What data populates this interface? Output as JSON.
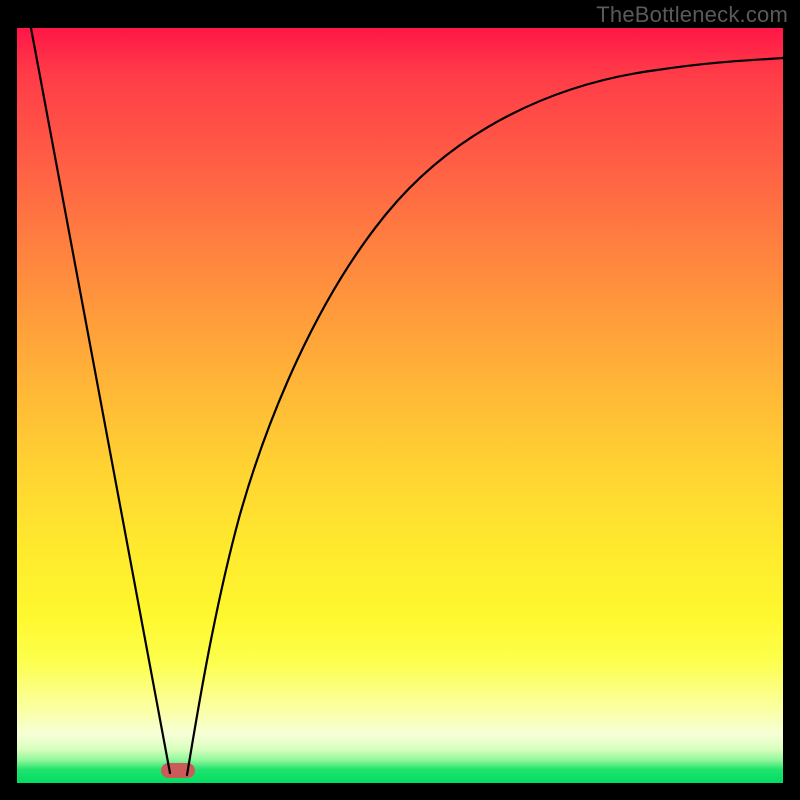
{
  "watermark": "TheBottleneck.com",
  "chart_data": {
    "type": "line",
    "title": "",
    "xlabel": "",
    "ylabel": "",
    "xlim": [
      0,
      100
    ],
    "ylim": [
      0,
      100
    ],
    "grid": false,
    "legend": false,
    "series": [
      {
        "name": "left-branch",
        "x": [
          0,
          5,
          10,
          15,
          19,
          20
        ],
        "values": [
          100,
          75,
          50,
          25,
          3,
          0
        ]
      },
      {
        "name": "right-branch",
        "x": [
          20,
          22,
          25,
          28,
          32,
          36,
          40,
          45,
          50,
          56,
          62,
          70,
          80,
          90,
          100
        ],
        "values": [
          0,
          8,
          20,
          32,
          45,
          56,
          64,
          72,
          78,
          83,
          87,
          90,
          93,
          95,
          96
        ]
      }
    ],
    "annotations": [
      {
        "name": "minimum-marker",
        "x": 20,
        "y": 0,
        "color": "#cb5a58"
      }
    ],
    "background_gradient": {
      "top": "#ff1648",
      "mid_upper": "#ffb238",
      "mid_lower": "#fef82e",
      "bottom": "#00dd62"
    }
  }
}
